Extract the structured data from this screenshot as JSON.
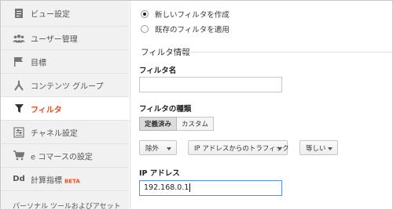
{
  "sidebar": {
    "items": [
      {
        "label": "ビュー設定",
        "icon": "document-icon"
      },
      {
        "label": "ユーザー管理",
        "icon": "users-icon"
      },
      {
        "label": "目標",
        "icon": "flag-icon"
      },
      {
        "label": "コンテンツ グループ",
        "icon": "content-group-icon"
      },
      {
        "label": "フィルタ",
        "icon": "filter-icon",
        "active": true
      },
      {
        "label": "チャネル設定",
        "icon": "channel-settings-icon"
      },
      {
        "label": "e コマースの設定",
        "icon": "cart-icon"
      },
      {
        "label": "計算指標",
        "icon": "calculated-metrics-icon",
        "badge": "BETA"
      }
    ],
    "bottom_label": "パーソナル ツールおよびアセット"
  },
  "main": {
    "radios": {
      "create_new": "新しいフィルタを作成",
      "apply_existing": "既存のフィルタを適用"
    },
    "section_title": "フィルタ情報",
    "filter_name_label": "フィルタ名",
    "filter_name_value": "",
    "filter_type_label": "フィルタの種類",
    "tabs": {
      "predefined": "定義済み",
      "custom": "カスタム"
    },
    "dropdowns": {
      "action": "除外",
      "source": "IP アドレスからのトラフィック",
      "operator": "等しい"
    },
    "ip_label": "IP アドレス",
    "ip_value": "192.168.0.1"
  },
  "colors": {
    "accent": "#e4501f",
    "focus": "#4d90fe",
    "sidebar_bg": "#f1f1f1"
  }
}
